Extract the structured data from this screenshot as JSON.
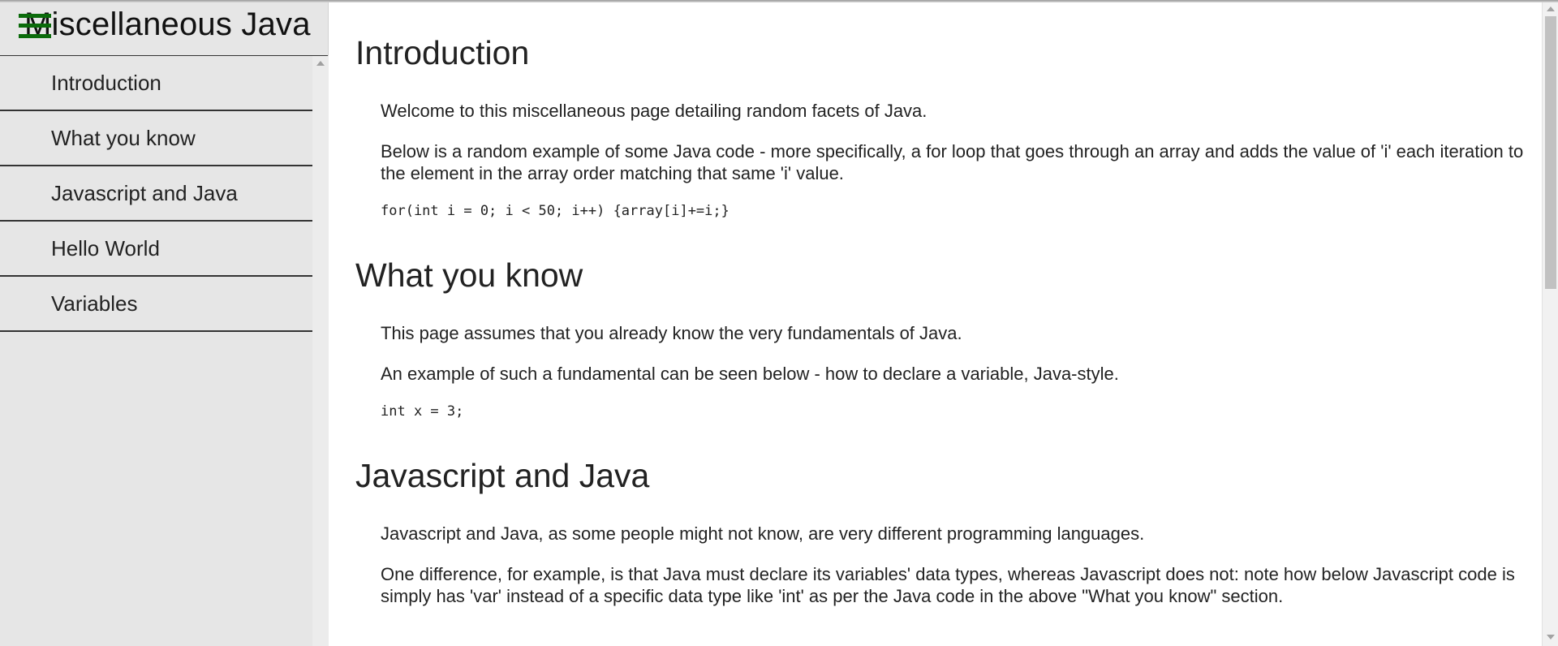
{
  "nav": {
    "title": "Miscellaneous Java",
    "menu_icon": "hamburger-menu-icon",
    "links": [
      {
        "label": "Introduction"
      },
      {
        "label": "What you know"
      },
      {
        "label": "Javascript and Java"
      },
      {
        "label": "Hello World"
      },
      {
        "label": "Variables"
      }
    ]
  },
  "sections": [
    {
      "title": "Introduction",
      "paragraphs": [
        "Welcome to this miscellaneous page detailing random facets of Java.",
        "Below is a random example of some Java code - more specifically, a for loop that goes through an array and adds the value of 'i' each iteration to the element in the array order matching that same 'i' value."
      ],
      "code": "for(int i = 0; i < 50; i++) {array[i]+=i;}"
    },
    {
      "title": "What you know",
      "paragraphs": [
        "This page assumes that you already know the very fundamentals of Java.",
        "An example of such a fundamental can be seen below - how to declare a variable, Java-style."
      ],
      "code": "int x = 3;"
    },
    {
      "title": "Javascript and Java",
      "paragraphs": [
        "Javascript and Java, as some people might not know, are very different programming languages.",
        "One difference, for example, is that Java must declare its variables' data types, whereas Javascript does not: note how below Javascript code is simply has 'var' instead of a specific data type like 'int' as per the Java code in the above \"What you know\" section."
      ]
    }
  ],
  "colors": {
    "sidebar_bg": "#e6e6e6",
    "menu_icon": "#0b6b0b",
    "text": "#222222"
  }
}
